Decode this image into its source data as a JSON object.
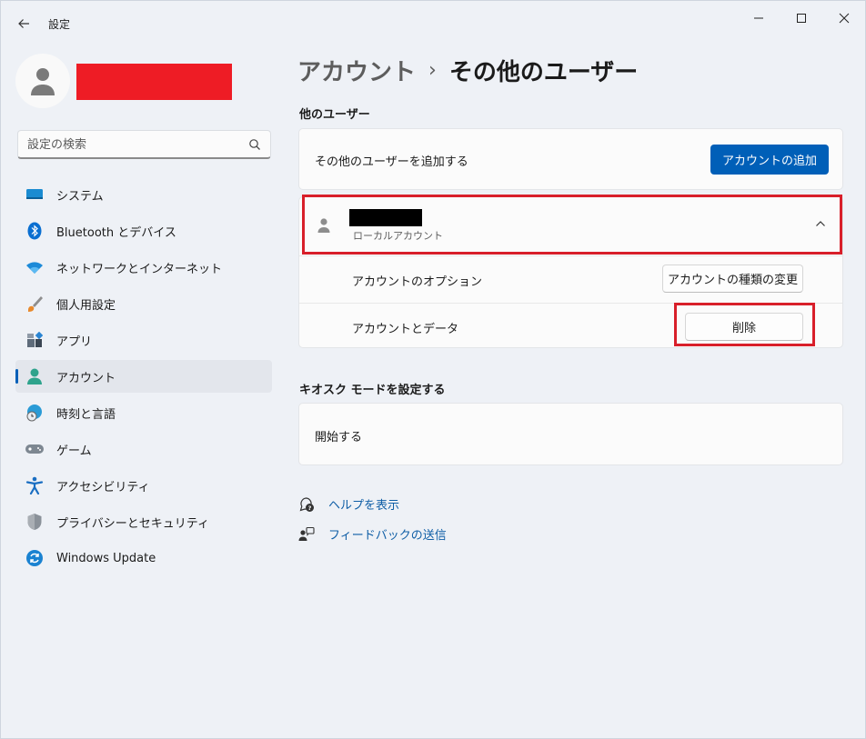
{
  "window": {
    "title": "設定"
  },
  "search": {
    "placeholder": "設定の検索"
  },
  "nav": {
    "items": [
      {
        "label": "システム"
      },
      {
        "label": "Bluetooth とデバイス"
      },
      {
        "label": "ネットワークとインターネット"
      },
      {
        "label": "個人用設定"
      },
      {
        "label": "アプリ"
      },
      {
        "label": "アカウント",
        "active": true
      },
      {
        "label": "時刻と言語"
      },
      {
        "label": "ゲーム"
      },
      {
        "label": "アクセシビリティ"
      },
      {
        "label": "プライバシーとセキュリティ"
      },
      {
        "label": "Windows Update"
      }
    ]
  },
  "breadcrumb": {
    "parent": "アカウント",
    "separator": "›",
    "current": "その他のユーザー"
  },
  "other_users": {
    "section_title": "他のユーザー",
    "add_label": "その他のユーザーを追加する",
    "add_button": "アカウントの追加",
    "user": {
      "type": "ローカルアカウント",
      "options_label": "アカウントのオプション",
      "change_type_button": "アカウントの種類の変更",
      "data_label": "アカウントとデータ",
      "delete_button": "削除"
    }
  },
  "kiosk": {
    "section_title": "キオスク モードを設定する",
    "start_label": "開始する"
  },
  "links": {
    "help": "ヘルプを表示",
    "feedback": "フィードバックの送信"
  },
  "colors": {
    "accent": "#005fb8",
    "highlight": "#d81f2a",
    "redaction_name": "#ee1c25"
  }
}
